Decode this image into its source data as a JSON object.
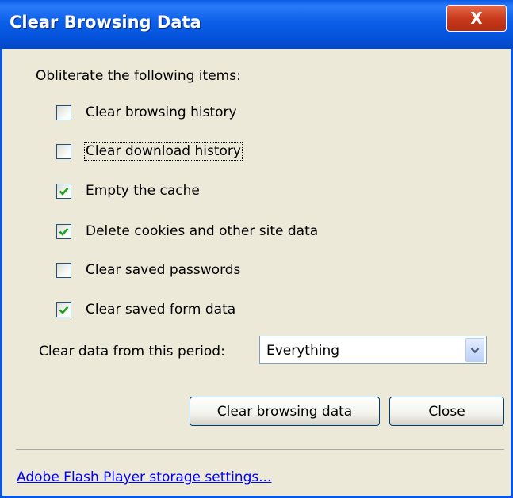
{
  "window": {
    "title": "Clear Browsing Data",
    "close_glyph": "X"
  },
  "form": {
    "heading": "Obliterate the following items:",
    "options": [
      {
        "label": "Clear browsing history",
        "checked": false
      },
      {
        "label": "Clear download history",
        "checked": false
      },
      {
        "label": "Empty the cache",
        "checked": true
      },
      {
        "label": "Delete cookies and other site data",
        "checked": true
      },
      {
        "label": "Clear saved passwords",
        "checked": false
      },
      {
        "label": "Clear saved form data",
        "checked": true
      }
    ],
    "period_label": "Clear data from this period:",
    "period_value": "Everything"
  },
  "buttons": {
    "clear": "Clear browsing data",
    "close": "Close"
  },
  "footer": {
    "link": "Adobe Flash Player storage settings..."
  },
  "colors": {
    "title_bar": "#0a57df",
    "dialog_bg": "#ece9d8",
    "check_mark": "#21a121",
    "link": "#0000ff"
  }
}
